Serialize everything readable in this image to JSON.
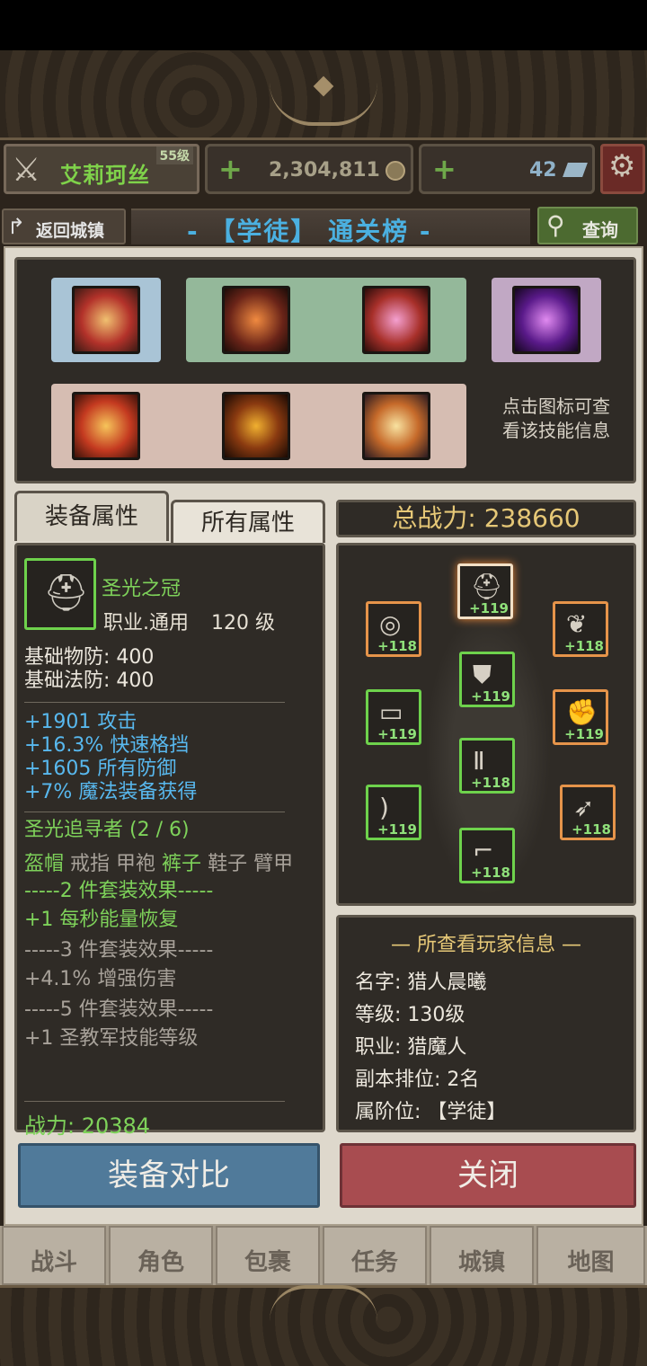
{
  "player": {
    "name": "艾莉珂丝",
    "level": "55级"
  },
  "resources": {
    "gold": "2,304,811",
    "gems": "42",
    "plus": "+"
  },
  "nav": {
    "back_label": "返回城镇",
    "title": "- 【学徒】 通关榜 -",
    "search_label": "查询"
  },
  "skills": {
    "hint": "点击图标可查看该技能信息",
    "row1": [
      "arrow-rain-skill-icon",
      "archer-skill-icon",
      "pink-slash-skill-icon",
      "purple-target-skill-icon"
    ],
    "row2": [
      "fire-claw-skill-icon",
      "crosshair-skill-icon",
      "spear-thrust-skill-icon"
    ]
  },
  "tabs": {
    "equip": "装备属性",
    "all": "所有属性"
  },
  "item": {
    "name": "圣光之冠",
    "job": "职业.通用",
    "level": "120 级",
    "base_pdef": "基础物防:  400",
    "base_mdef": "基础法防:  400",
    "bonuses": [
      "+1901 攻击",
      "+16.3% 快速格挡",
      "+1605 所有防御",
      "+7% 魔法装备获得"
    ],
    "set_name": "圣光追寻者 (2 / 6)",
    "set_pieces": [
      {
        "name": "盔帽",
        "owned": true
      },
      {
        "name": "戒指",
        "owned": false
      },
      {
        "name": "甲袍",
        "owned": false
      },
      {
        "name": "裤子",
        "owned": true
      },
      {
        "name": "鞋子",
        "owned": false
      },
      {
        "name": "臂甲",
        "owned": false
      }
    ],
    "set2_header": "-----2 件套装效果-----",
    "set2_effect": "+1 每秒能量恢复",
    "set3_header": "-----3 件套装效果-----",
    "set3_effect": "+4.1% 增强伤害",
    "set5_header": "-----5 件套装效果-----",
    "set5_effect": "+1 圣教军技能等级",
    "power": "战力:   20384"
  },
  "total_power": "总战力:   238660",
  "equipment": [
    {
      "slot": "helmet",
      "icon": "helmet-icon",
      "level": "+119",
      "rarity": "green",
      "selected": true
    },
    {
      "slot": "ring",
      "icon": "ring-icon",
      "level": "+118",
      "rarity": "orange"
    },
    {
      "slot": "necklace",
      "icon": "necklace-icon",
      "level": "+118",
      "rarity": "orange"
    },
    {
      "slot": "armor",
      "icon": "chest-armor-icon",
      "level": "+119",
      "rarity": "green"
    },
    {
      "slot": "belt",
      "icon": "belt-icon",
      "level": "+119",
      "rarity": "green"
    },
    {
      "slot": "gloves",
      "icon": "gauntlet-icon",
      "level": "+119",
      "rarity": "orange"
    },
    {
      "slot": "pants",
      "icon": "pants-icon",
      "level": "+118",
      "rarity": "green"
    },
    {
      "slot": "weapon",
      "icon": "bow-icon",
      "level": "+119",
      "rarity": "green"
    },
    {
      "slot": "quiver",
      "icon": "quiver-icon",
      "level": "+118",
      "rarity": "orange"
    },
    {
      "slot": "boots",
      "icon": "boots-icon",
      "level": "+118",
      "rarity": "green"
    }
  ],
  "viewed_player": {
    "title": "— 所查看玩家信息 —",
    "name": "名字:   猎人晨曦",
    "level": "等级:   130级",
    "job": "职业:   猎魔人",
    "rank": "副本排位:   2名",
    "tier": "属阶位: 【学徒】"
  },
  "buttons": {
    "compare": "装备对比",
    "close": "关闭"
  },
  "bottom_nav": [
    "战斗",
    "角色",
    "包裹",
    "任务",
    "城镇",
    "地图"
  ],
  "colors": {
    "green": "#7ed25a",
    "blue": "#58b8ee",
    "gold": "#e6c877",
    "compare": "#507a9a",
    "close": "#a84c50"
  }
}
